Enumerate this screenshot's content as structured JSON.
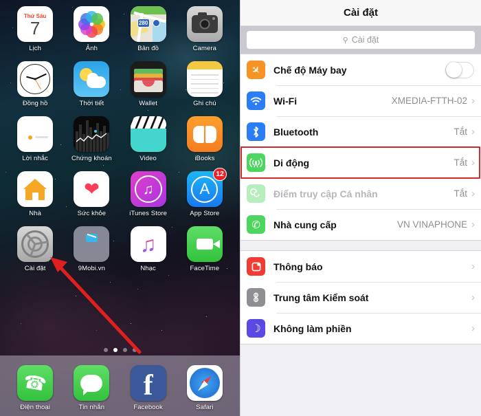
{
  "home": {
    "apps": [
      {
        "name": "Lịch",
        "icon": "calendar-icon",
        "cal_weekday": "Thứ Sáu",
        "cal_day": "7"
      },
      {
        "name": "Ảnh",
        "icon": "photos-icon"
      },
      {
        "name": "Bản đồ",
        "icon": "maps-icon",
        "maps_route": "280"
      },
      {
        "name": "Camera",
        "icon": "camera-icon"
      },
      {
        "name": "Đồng hồ",
        "icon": "clock-icon"
      },
      {
        "name": "Thời tiết",
        "icon": "weather-icon"
      },
      {
        "name": "Wallet",
        "icon": "wallet-icon"
      },
      {
        "name": "Ghi chú",
        "icon": "notes-icon"
      },
      {
        "name": "Lời nhắc",
        "icon": "reminders-icon"
      },
      {
        "name": "Chứng khoán",
        "icon": "stocks-icon"
      },
      {
        "name": "Video",
        "icon": "video-icon"
      },
      {
        "name": "iBooks",
        "icon": "ibooks-icon"
      },
      {
        "name": "Nhà",
        "icon": "home-app-icon"
      },
      {
        "name": "Sức khỏe",
        "icon": "health-icon"
      },
      {
        "name": "iTunes Store",
        "icon": "itunes-store-icon"
      },
      {
        "name": "App Store",
        "icon": "app-store-icon",
        "badge": "12"
      },
      {
        "name": "Cài đặt",
        "icon": "settings-gear-icon"
      },
      {
        "name": "9Mobi.vn",
        "icon": "9mobi-icon"
      },
      {
        "name": "Nhạc",
        "icon": "music-icon"
      },
      {
        "name": "FaceTime",
        "icon": "facetime-icon"
      }
    ],
    "dock": [
      {
        "name": "Điện thoại",
        "icon": "phone-icon"
      },
      {
        "name": "Tin nhắn",
        "icon": "messages-icon"
      },
      {
        "name": "Facebook",
        "icon": "facebook-icon"
      },
      {
        "name": "Safari",
        "icon": "safari-icon"
      }
    ],
    "page_dots": {
      "count": 4,
      "active_index": 1
    },
    "annotation": {
      "type": "arrow",
      "color": "#e01f1f",
      "points_to": "Cài đặt"
    }
  },
  "settings": {
    "title": "Cài đặt",
    "search": {
      "placeholder": "Cài đặt",
      "icon": "search-icon"
    },
    "group1": [
      {
        "label": "Chế độ Máy bay",
        "icon": "airplane-icon",
        "icon_color": "#f79325",
        "control": "toggle",
        "toggle_on": false
      },
      {
        "label": "Wi-Fi",
        "icon": "wifi-icon",
        "icon_color": "#2a7df4",
        "value": "XMEDIA-FTTH-02",
        "control": "chevron"
      },
      {
        "label": "Bluetooth",
        "icon": "bluetooth-icon",
        "icon_color": "#2a7df4",
        "value": "Tắt",
        "control": "chevron"
      },
      {
        "label": "Di động",
        "icon": "cellular-icon",
        "icon_color": "#4cd55f",
        "value": "Tắt",
        "control": "chevron",
        "highlighted": true
      },
      {
        "label": "Điểm truy cập Cá nhân",
        "icon": "hotspot-icon",
        "icon_color": "#4cd55f",
        "value": "Tắt",
        "control": "chevron",
        "disabled": true
      },
      {
        "label": "Nhà cung cấp",
        "icon": "carrier-phone-icon",
        "icon_color": "#4cd55f",
        "value": "VN VINAPHONE",
        "control": "chevron"
      }
    ],
    "group2": [
      {
        "label": "Thông báo",
        "icon": "notifications-icon",
        "icon_color": "#f03c34",
        "control": "chevron"
      },
      {
        "label": "Trung tâm Kiểm soát",
        "icon": "control-center-icon",
        "icon_color": "#8e8e93",
        "control": "chevron"
      },
      {
        "label": "Không làm phiền",
        "icon": "do-not-disturb-icon",
        "icon_color": "#5a4ae3",
        "control": "chevron"
      }
    ],
    "highlight_color": "#d22a2a"
  }
}
